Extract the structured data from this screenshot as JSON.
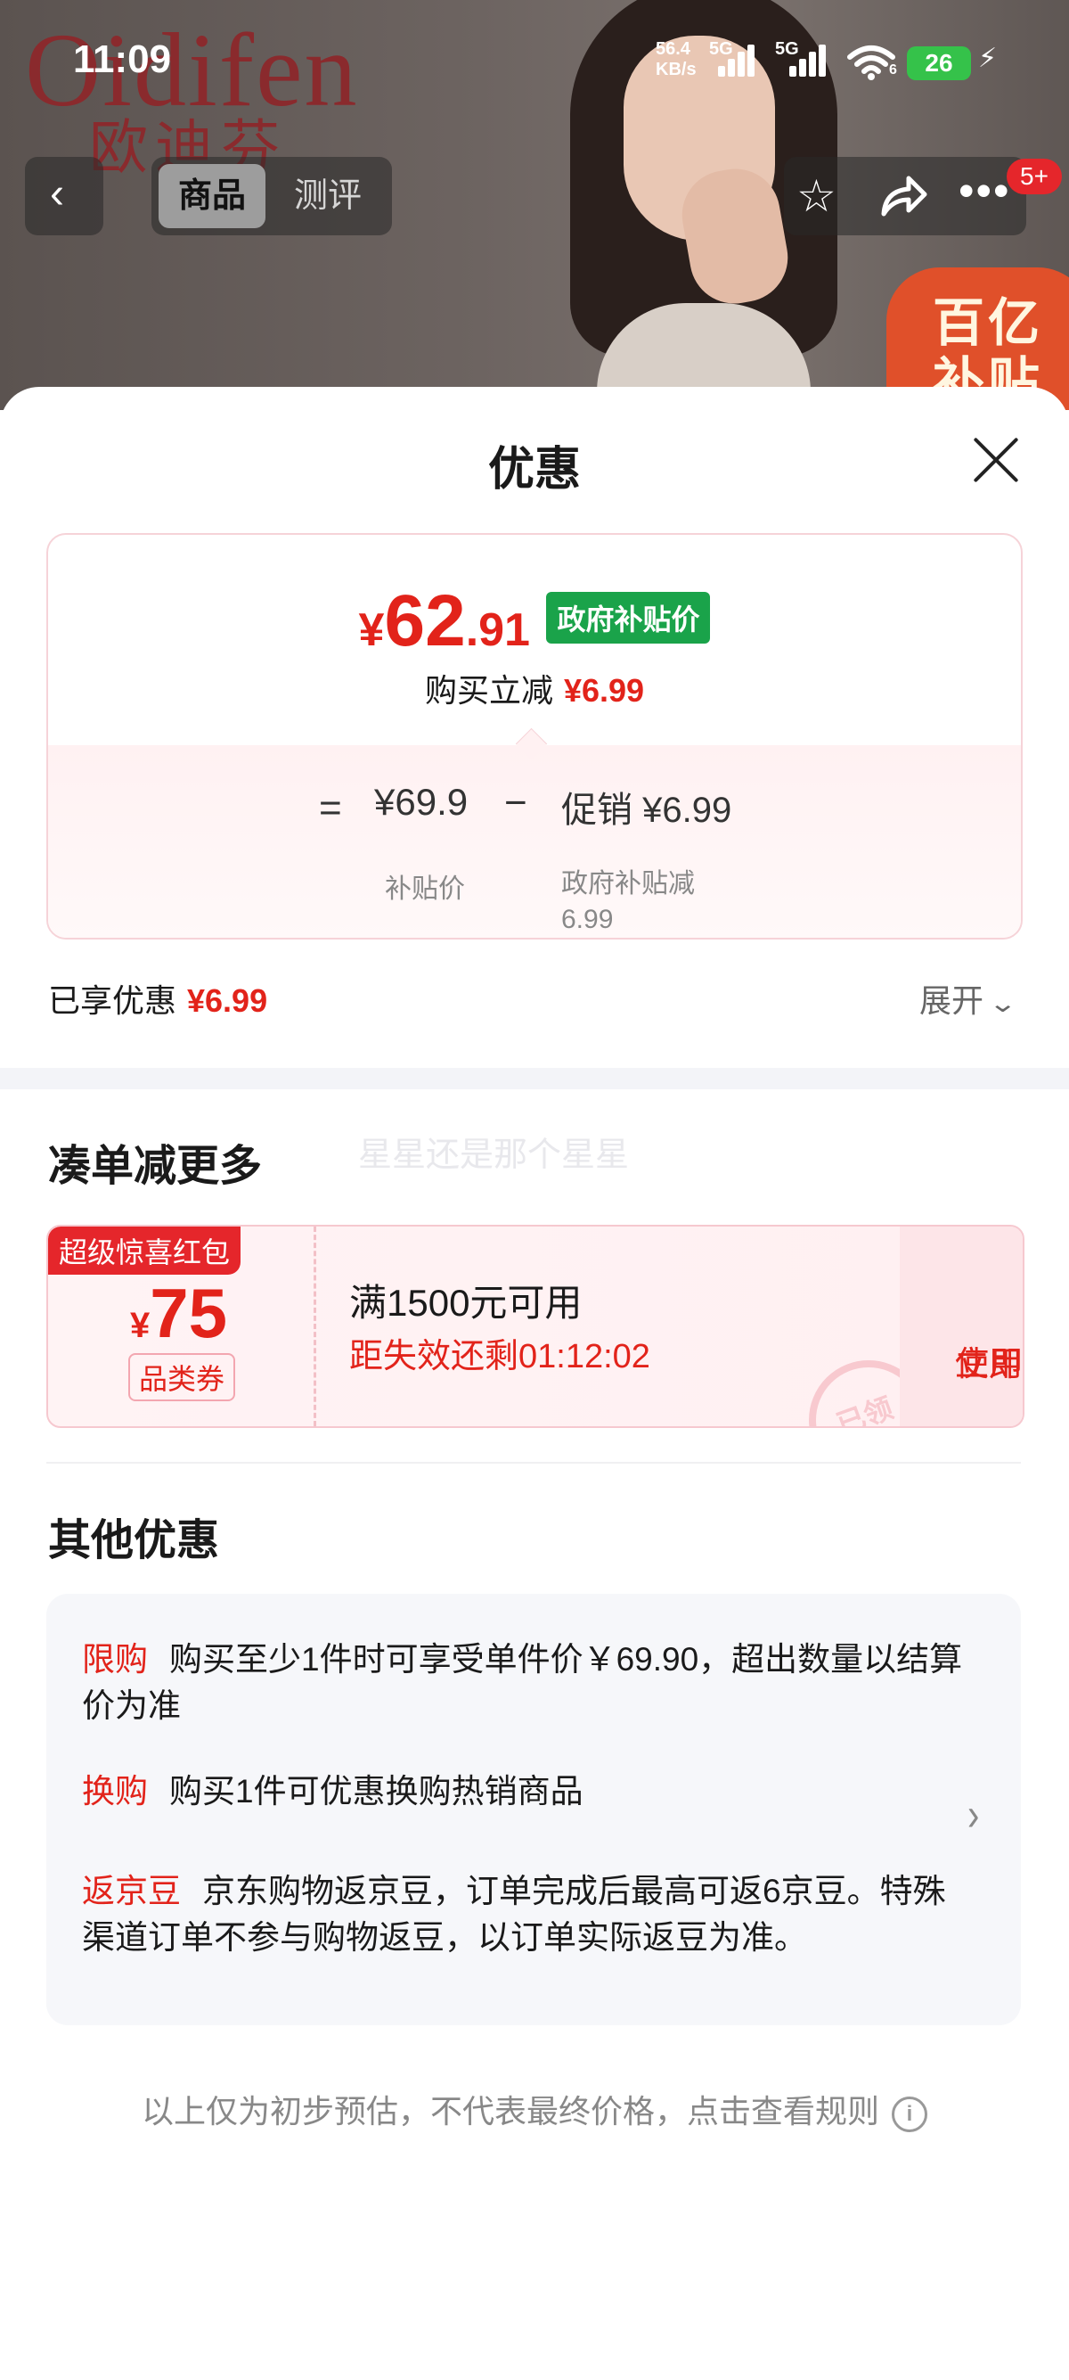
{
  "status_bar": {
    "time": "11:09",
    "net_speed_value": "56.4",
    "net_speed_unit": "KB/s",
    "signal1_label": "5G",
    "signal2_label": "5G",
    "wifi_sub": "6",
    "battery": "26"
  },
  "hero": {
    "brand_latin": "Oidifen",
    "brand_cn": "欧迪芬",
    "subsidy_badge": "百亿补贴"
  },
  "nav": {
    "tab_product": "商品",
    "tab_review": "测评",
    "message_badge": "5+"
  },
  "sheet": {
    "title": "优惠",
    "price": {
      "currency": "¥",
      "integer": "62",
      "decimal": ".91",
      "tag": "政府补贴价",
      "instant_cut_label": "购买立减",
      "instant_cut_value": "¥6.99",
      "equals": "=",
      "base_price": "¥69.9",
      "minus": "−",
      "promo": "促销 ¥6.99",
      "base_label": "补贴价",
      "promo_label_line1": "政府补贴减",
      "promo_label_line2": "6.99"
    },
    "enjoyed_label": "已享优惠",
    "enjoyed_value": "¥6.99",
    "expand_label": "展开"
  },
  "bundle": {
    "title": "凑单减更多",
    "watermark": "星星还是那个星星",
    "coupon": {
      "ribbon": "超级惊喜红包",
      "currency": "¥",
      "amount": "75",
      "type": "品类券",
      "condition": "满1500元可用",
      "timer": "距失效还剩01:12:02",
      "use_line1": "立即",
      "use_line2": "使用",
      "stamp": "已领"
    }
  },
  "other": {
    "title": "其他优惠",
    "items": [
      {
        "tag": "限购",
        "text": "购买至少1件时可享受单件价￥69.90，超出数量以结算价为准"
      },
      {
        "tag": "换购",
        "text": "购买1件可优惠换购热销商品"
      },
      {
        "tag": "返京豆",
        "text": "京东购物返京豆，订单完成后最高可返6京豆。特殊渠道订单不参与购物返豆，以订单实际返豆为准。"
      }
    ]
  },
  "footer": {
    "note": "以上仅为初步预估，不代表最终价格，点击查看规则",
    "info_glyph": "i"
  },
  "colors": {
    "accent_red": "#e2231a",
    "gov_green": "#1aa34a",
    "battery_green": "#35c24a"
  }
}
